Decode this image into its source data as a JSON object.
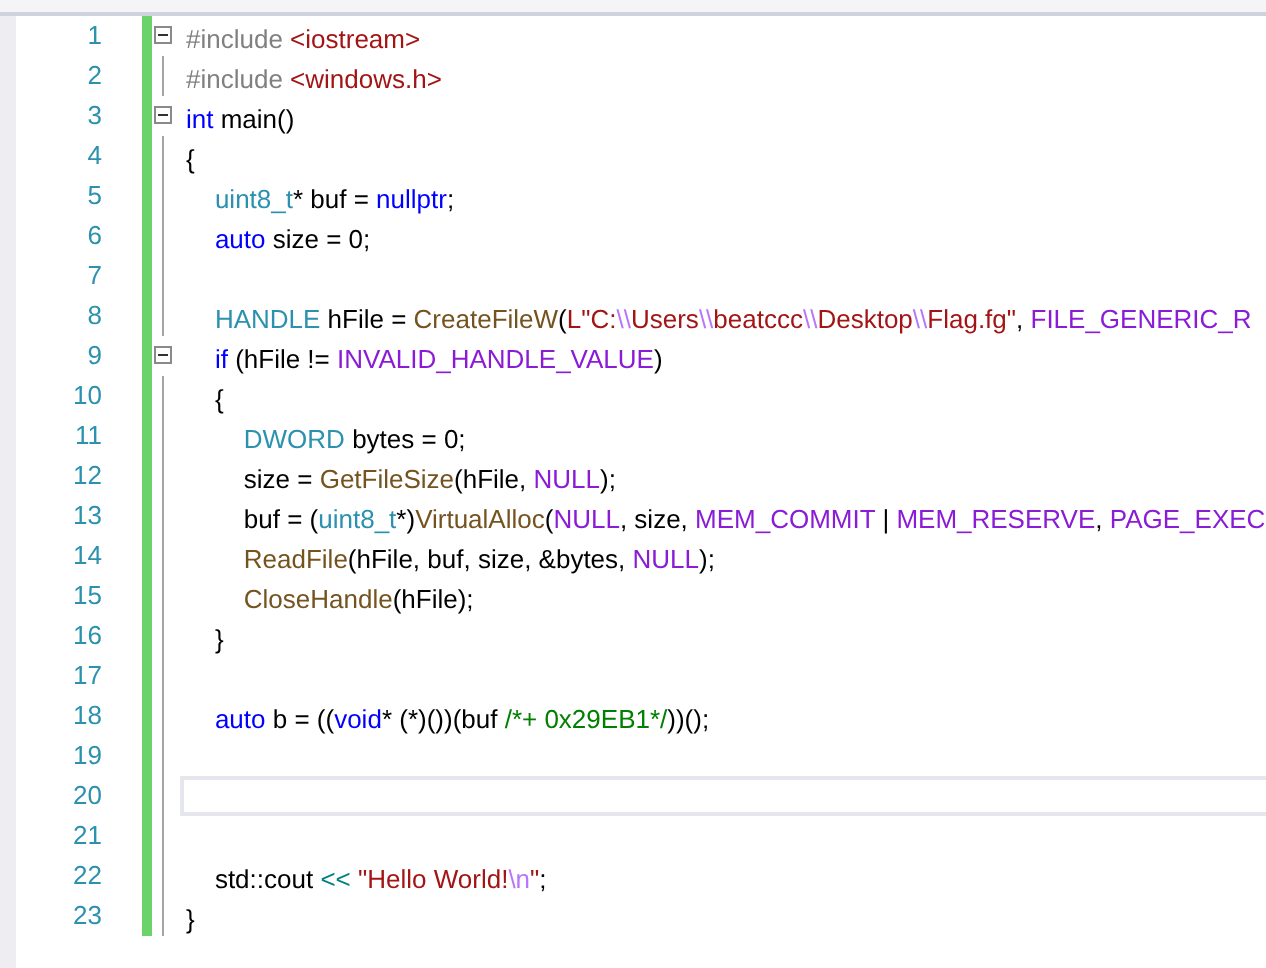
{
  "lines": [
    {
      "number": "1",
      "modified": true,
      "current": false,
      "fold_expanded": true,
      "tokens": [
        {
          "kind": "preproc",
          "text": "#include "
        },
        {
          "kind": "include",
          "text": "<iostream>"
        }
      ]
    },
    {
      "number": "2",
      "modified": true,
      "current": false,
      "tokens": [
        {
          "kind": "preproc",
          "text": "#include "
        },
        {
          "kind": "include",
          "text": "<windows.h>"
        }
      ]
    },
    {
      "number": "3",
      "modified": true,
      "current": false,
      "fold_expanded": true,
      "tokens": [
        {
          "kind": "keyword",
          "text": "int"
        },
        {
          "kind": "plain",
          "text": " main()"
        }
      ]
    },
    {
      "number": "4",
      "modified": true,
      "current": false,
      "tokens": [
        {
          "kind": "plain",
          "text": "{"
        }
      ]
    },
    {
      "number": "5",
      "modified": true,
      "current": false,
      "tokens": [
        {
          "kind": "type",
          "text": "    uint8_t"
        },
        {
          "kind": "plain",
          "text": "* buf = "
        },
        {
          "kind": "keyword",
          "text": "nullptr"
        },
        {
          "kind": "plain",
          "text": ";"
        }
      ]
    },
    {
      "number": "6",
      "modified": true,
      "current": false,
      "tokens": [
        {
          "kind": "keyword",
          "text": "    auto"
        },
        {
          "kind": "plain",
          "text": " size = 0;"
        }
      ]
    },
    {
      "number": "7",
      "modified": true,
      "current": false
    },
    {
      "number": "8",
      "modified": true,
      "current": false,
      "tokens": [
        {
          "kind": "type",
          "text": "    HANDLE"
        },
        {
          "kind": "plain",
          "text": " hFile = "
        },
        {
          "kind": "function",
          "text": "CreateFileW"
        },
        {
          "kind": "plain",
          "text": "("
        },
        {
          "kind": "string",
          "text": "L\"C:"
        },
        {
          "kind": "escape",
          "text": "\\\\"
        },
        {
          "kind": "string",
          "text": "Users"
        },
        {
          "kind": "escape",
          "text": "\\\\"
        },
        {
          "kind": "string",
          "text": "beatccc"
        },
        {
          "kind": "escape",
          "text": "\\\\"
        },
        {
          "kind": "string",
          "text": "Desktop"
        },
        {
          "kind": "escape",
          "text": "\\\\"
        },
        {
          "kind": "string",
          "text": "Flag.fg\""
        },
        {
          "kind": "plain",
          "text": ", "
        },
        {
          "kind": "macro",
          "text": "FILE_GENERIC_R"
        }
      ]
    },
    {
      "number": "9",
      "modified": true,
      "current": false,
      "fold_expanded": true,
      "tokens": [
        {
          "kind": "keyword",
          "text": "    if"
        },
        {
          "kind": "plain",
          "text": " (hFile != "
        },
        {
          "kind": "macro",
          "text": "INVALID_HANDLE_VALUE"
        },
        {
          "kind": "plain",
          "text": ")"
        }
      ]
    },
    {
      "number": "10",
      "modified": true,
      "current": false,
      "tokens": [
        {
          "kind": "plain",
          "text": "    {"
        }
      ]
    },
    {
      "number": "11",
      "modified": true,
      "current": false,
      "tokens": [
        {
          "kind": "type",
          "text": "        DWORD"
        },
        {
          "kind": "plain",
          "text": " bytes = 0;"
        }
      ]
    },
    {
      "number": "12",
      "modified": true,
      "current": false,
      "tokens": [
        {
          "kind": "plain",
          "text": "        size = "
        },
        {
          "kind": "function",
          "text": "GetFileSize"
        },
        {
          "kind": "plain",
          "text": "(hFile, "
        },
        {
          "kind": "macro",
          "text": "NULL"
        },
        {
          "kind": "plain",
          "text": ");"
        }
      ]
    },
    {
      "number": "13",
      "modified": true,
      "current": false,
      "tokens": [
        {
          "kind": "plain",
          "text": "        buf = ("
        },
        {
          "kind": "type",
          "text": "uint8_t"
        },
        {
          "kind": "plain",
          "text": "*)"
        },
        {
          "kind": "function",
          "text": "VirtualAlloc"
        },
        {
          "kind": "plain",
          "text": "("
        },
        {
          "kind": "macro",
          "text": "NULL"
        },
        {
          "kind": "plain",
          "text": ", size, "
        },
        {
          "kind": "macro",
          "text": "MEM_COMMIT"
        },
        {
          "kind": "plain",
          "text": " | "
        },
        {
          "kind": "macro",
          "text": "MEM_RESERVE"
        },
        {
          "kind": "plain",
          "text": ", "
        },
        {
          "kind": "macro",
          "text": "PAGE_EXEC"
        }
      ]
    },
    {
      "number": "14",
      "modified": true,
      "current": false,
      "tokens": [
        {
          "kind": "function",
          "text": "        ReadFile"
        },
        {
          "kind": "plain",
          "text": "(hFile, buf, size, &bytes, "
        },
        {
          "kind": "macro",
          "text": "NULL"
        },
        {
          "kind": "plain",
          "text": ");"
        }
      ]
    },
    {
      "number": "15",
      "modified": true,
      "current": false,
      "tokens": [
        {
          "kind": "function",
          "text": "        CloseHandle"
        },
        {
          "kind": "plain",
          "text": "(hFile);"
        }
      ]
    },
    {
      "number": "16",
      "modified": true,
      "current": false,
      "tokens": [
        {
          "kind": "plain",
          "text": "    }"
        }
      ]
    },
    {
      "number": "17",
      "modified": true,
      "current": false
    },
    {
      "number": "18",
      "modified": true,
      "current": false,
      "tokens": [
        {
          "kind": "keyword",
          "text": "    auto"
        },
        {
          "kind": "plain",
          "text": " b = (("
        },
        {
          "kind": "keyword",
          "text": "void"
        },
        {
          "kind": "plain",
          "text": "* (*)())(buf "
        },
        {
          "kind": "comment",
          "text": "/*+ 0x29EB1*/"
        },
        {
          "kind": "plain",
          "text": "))();"
        }
      ]
    },
    {
      "number": "19",
      "modified": true,
      "current": false
    },
    {
      "number": "20",
      "modified": true,
      "current": true
    },
    {
      "number": "21",
      "modified": true,
      "current": false
    },
    {
      "number": "22",
      "modified": true,
      "current": false,
      "tokens": [
        {
          "kind": "plain",
          "text": "    std::cout "
        },
        {
          "kind": "operator",
          "text": "<<"
        },
        {
          "kind": "string",
          "text": " \"Hello World!"
        },
        {
          "kind": "escape",
          "text": "\\n"
        },
        {
          "kind": "string",
          "text": "\""
        },
        {
          "kind": "plain",
          "text": ";"
        }
      ]
    },
    {
      "number": "23",
      "modified": true,
      "current": false,
      "tokens": [
        {
          "kind": "plain",
          "text": "}"
        }
      ]
    }
  ]
}
